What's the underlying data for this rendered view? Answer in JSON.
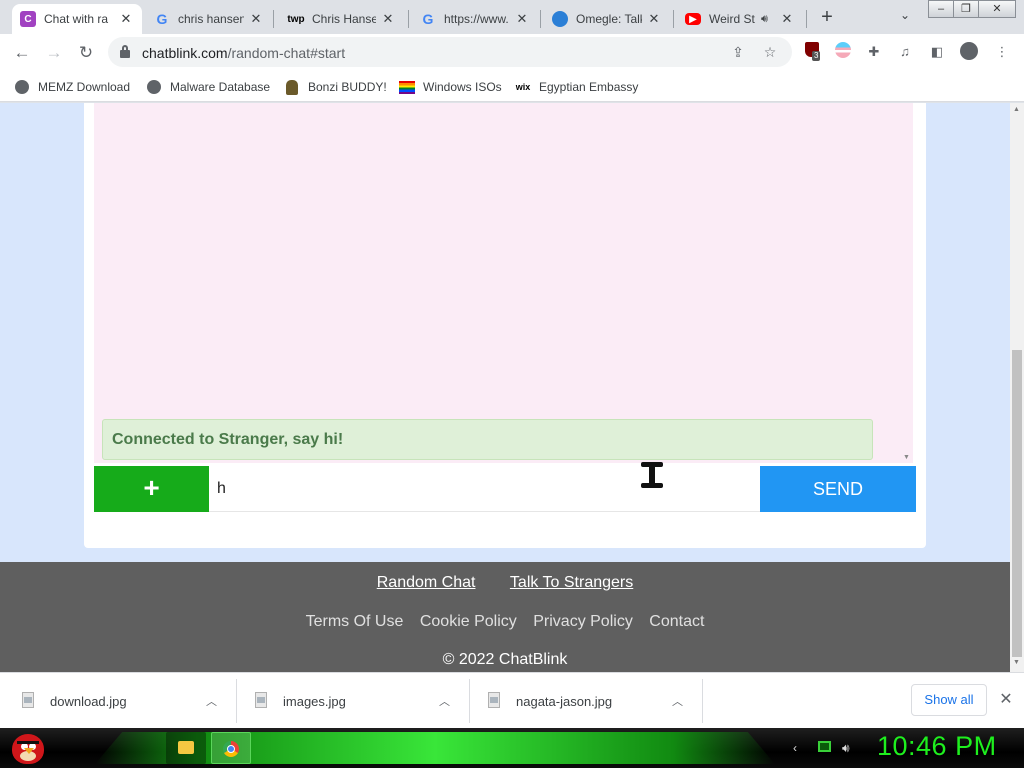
{
  "browser": {
    "tabs": [
      {
        "title": "Chat with ra",
        "favicon": "C",
        "favicon_color": "#a142c1",
        "active": true
      },
      {
        "title": "chris hansen",
        "favicon": "G",
        "favicon_color": "#4285f4",
        "active": false
      },
      {
        "title": "Chris Hansen",
        "favicon": "twp",
        "favicon_color": "#000000",
        "active": false
      },
      {
        "title": "https://www.",
        "favicon": "G",
        "favicon_color": "#4285f4",
        "active": false
      },
      {
        "title": "Omegle: Talk",
        "favicon": "omegle-icon",
        "favicon_color": "#2b7fd6",
        "active": false
      },
      {
        "title": "Weird St",
        "favicon": "youtube-icon",
        "favicon_color": "#ff0000",
        "active": false,
        "audio": true
      }
    ],
    "url_host": "chatblink.com",
    "url_path": "/random-chat#start",
    "extension_badge": "3",
    "bookmarks": [
      {
        "label": "MEMZ Download",
        "icon": "globe-icon"
      },
      {
        "label": "Malware Database",
        "icon": "globe-icon"
      },
      {
        "label": "Bonzi BUDDY!",
        "icon": "bonzi-icon"
      },
      {
        "label": "Windows ISOs",
        "icon": "rainbow-flag-icon"
      },
      {
        "label": "Egyptian Embassy",
        "icon": "wix-icon"
      }
    ]
  },
  "chat": {
    "status_message": "Connected to Stranger, say hi!",
    "input_value": "h",
    "plus_label": "+",
    "send_label": "SEND"
  },
  "footer": {
    "primary_links": [
      "Random Chat",
      "Talk To Strangers"
    ],
    "secondary_links": [
      "Terms Of Use",
      "Cookie Policy",
      "Privacy Policy",
      "Contact"
    ],
    "copyright": "© 2022 ChatBlink"
  },
  "downloads": {
    "items": [
      "download.jpg",
      "images.jpg",
      "nagata-jason.jpg"
    ],
    "show_all": "Show all"
  },
  "taskbar": {
    "clock": "10:46 PM"
  },
  "colors": {
    "accent_green": "#16ab1a",
    "send_blue": "#2196f3",
    "page_bg": "#d8e6fc",
    "chat_log_bg": "#fbecf6",
    "status_bg": "#dff0d8",
    "footer_bg": "#5f5f5f",
    "clock_green": "#1eef1e"
  }
}
